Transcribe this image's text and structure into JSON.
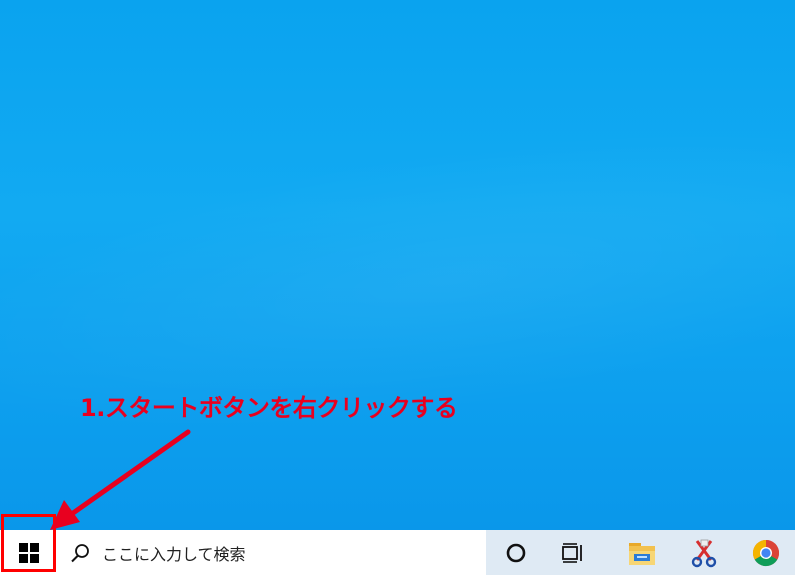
{
  "annotation": {
    "instruction": "1.スタートボタンを右クリックする",
    "color": "#e8001f",
    "highlight_color": "#ff0000"
  },
  "taskbar": {
    "search": {
      "placeholder": "ここに入力して検索",
      "icon": "search-icon"
    },
    "start_icon": "windows-logo-icon",
    "pinned": [
      {
        "name": "cortana",
        "icon": "cortana-circle-icon"
      },
      {
        "name": "task-view",
        "icon": "task-view-icon"
      },
      {
        "name": "file-explorer",
        "icon": "folder-icon"
      },
      {
        "name": "snipping-tool",
        "icon": "scissors-icon"
      },
      {
        "name": "chrome",
        "icon": "chrome-icon"
      }
    ]
  },
  "colors": {
    "desktop": "#0ea5f0",
    "taskbar": "#dfeaf4",
    "search_bg": "#ffffff"
  }
}
